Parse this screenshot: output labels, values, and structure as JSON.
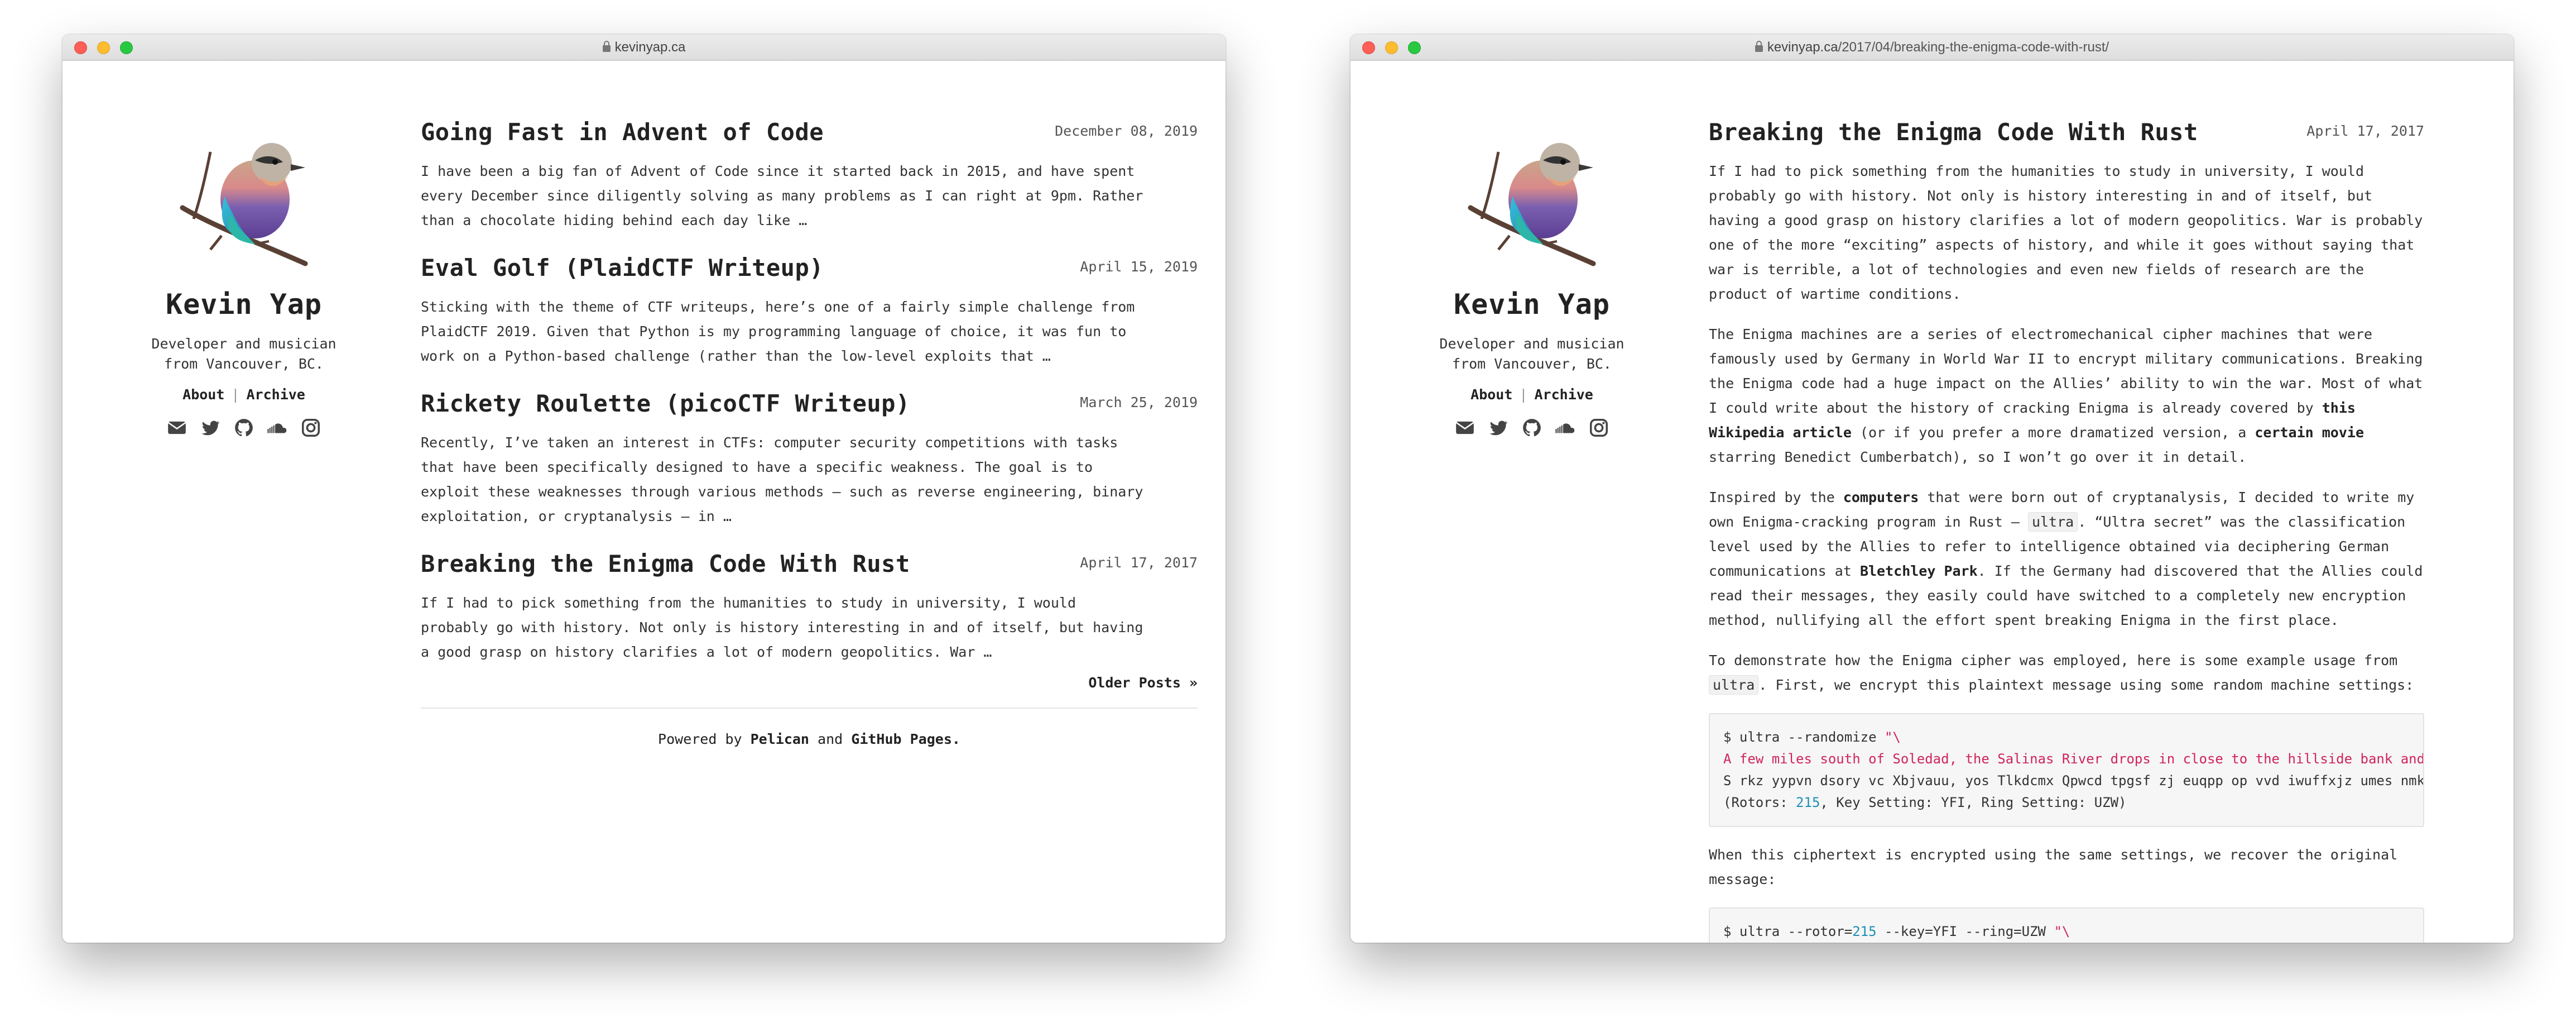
{
  "left_window": {
    "url": "kevinyap.ca",
    "sidebar": {
      "name": "Kevin Yap",
      "tagline": "Developer and musician\nfrom Vancouver, BC.",
      "nav": [
        "About",
        "Archive"
      ],
      "socials": [
        "envelope-icon",
        "twitter-icon",
        "github-icon",
        "soundcloud-icon",
        "instagram-icon"
      ]
    },
    "posts": [
      {
        "title": "Going Fast in Advent of Code",
        "date": "December 08, 2019",
        "excerpt": "I have been a big fan of Advent of Code since it started back in 2015, and have spent every December since diligently solving as many problems as I can right at 9pm. Rather than a chocolate hiding behind each day like …"
      },
      {
        "title": "Eval Golf (PlaidCTF Writeup)",
        "date": "April 15, 2019",
        "excerpt": "Sticking with the theme of CTF writeups, here’s one of a fairly simple challenge from PlaidCTF 2019. Given that Python is my programming language of choice, it was fun to work on a Python-based challenge (rather than the low-level exploits that …"
      },
      {
        "title": "Rickety Roulette (picoCTF Writeup)",
        "date": "March 25, 2019",
        "excerpt": "Recently, I’ve taken an interest in CTFs: computer security competitions with tasks that have been specifically designed to have a specific weakness. The goal is to exploit these weaknesses through various methods — such as reverse engineering, binary exploitation, or cryptanalysis — in …"
      },
      {
        "title": "Breaking the Enigma Code With Rust",
        "date": "April 17, 2017",
        "excerpt": "If I had to pick something from the humanities to study in university, I would probably go with history. Not only is history interesting in and of itself, but having a good grasp on history clarifies a lot of modern geopolitics. War …"
      }
    ],
    "older_posts": "Older Posts »",
    "footer": {
      "prefix": "Powered by",
      "pelican": "Pelican",
      "and": "and",
      "github_pages": "GitHub Pages",
      "suffix": "."
    }
  },
  "right_window": {
    "url_domain": "kevinyap.ca",
    "url_path": "/2017/04/breaking-the-enigma-code-with-rust/",
    "article": {
      "title": "Breaking the Enigma Code With Rust",
      "date": "April 17, 2017",
      "p1": "If I had to pick something from the humanities to study in university, I would probably go with history. Not only is history interesting in and of itself, but having a good grasp on history clarifies a lot of modern geopolitics. War is probably one of the more “exciting” aspects of history, and while it goes without saying that war is terrible, a lot of technologies and even new fields of research are the product of wartime conditions.",
      "p2_a": "The Enigma machines are a series of electromechanical cipher machines that were famously used by Germany in World War II to encrypt military communications. Breaking the Enigma code had a huge impact on the Allies’ ability to win the war. Most of what I could write about the history of cracking Enigma is already covered by ",
      "p2_link1": "this Wikipedia article",
      "p2_b": " (or if you prefer a more dramatized version, a ",
      "p2_link2": "certain movie",
      "p2_c": " starring Benedict Cumberbatch), so I won’t go over it in detail.",
      "p3_a": "Inspired by the ",
      "p3_link1": "computers",
      "p3_b": " that were born out of cryptanalysis, I decided to write my own Enigma-cracking program in Rust — ",
      "p3_code": "ultra",
      "p3_c": ". “Ultra secret” was the classification level used by the Allies to refer to intelligence obtained via deciphering German communications at ",
      "p3_link2": "Bletchley Park",
      "p3_d": ". If the Germany had discovered that the Allies could read their messages, they easily could have switched to a completely new encryption method, nullifying all the effort spent breaking Enigma in the first place.",
      "p4_a": "To demonstrate how the Enigma cipher was employed, here is some example usage from ",
      "p4_code": "ultra",
      "p4_b": ". First, we encrypt this plaintext message using some random machine settings:",
      "code_line1_cmd": "$ ultra --randomize ",
      "code_line1_str": "\"\\",
      "code_line2": "A few miles south of Soledad, the Salinas River drops in close to the hillside bank and",
      "code_line3": "S rkz yypvn dsory vc Xbjvauu, yos Tlkdcmx Qpwcd tpgsf zj euqpp op vvd iwuffxjz umes nmk",
      "code_line4_a": "(Rotors: ",
      "code_line4_num": "215",
      "code_line4_b": ", Key Setting: YFI, Ring Setting: UZW)",
      "p5": "When this ciphertext is encrypted using the same settings, we recover the original message:",
      "code2_a": "$ ultra --rotor=",
      "code2_num": "215",
      "code2_b": " --key=YFI --ring=UZW ",
      "code2_str": "\"\\"
    }
  }
}
